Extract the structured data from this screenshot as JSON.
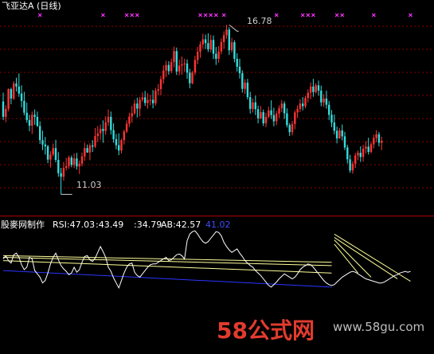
{
  "header": {
    "title": "飞亚达A (日线)"
  },
  "price_labels": {
    "high": "16.78",
    "low": "11.03"
  },
  "indicator": {
    "name": "股麥网制作",
    "rsi_label": "RSI:47.03",
    "val2": ":43.49",
    "val3": ":34.79",
    "ab_label": "AB:42.57",
    "ab2": "41.02"
  },
  "watermark": {
    "num": "58",
    "text": "公式网",
    "url": "www.58gu.com"
  },
  "colors": {
    "up_candle": "#ff3333",
    "down_candle": "#33dddd",
    "indicator_line": "#ffffff",
    "trend_line_yellow": "#ffff99",
    "trend_line_blue": "#2b35ff",
    "marker": "#ff33ff",
    "gridline": "#8b0000",
    "panel_divider": "#b30000"
  },
  "chart_data": [
    {
      "type": "candlestick",
      "title": "飞亚达A (日线)",
      "ylim": [
        10.5,
        17.3
      ],
      "grid": true,
      "annotations": [
        {
          "text": "16.78",
          "kind": "high",
          "at_index": 86,
          "value": 16.78
        },
        {
          "text": "11.03",
          "kind": "low",
          "at_index": 22,
          "value": 11.03
        }
      ],
      "signal_marker_indices": [
        14,
        38,
        47,
        49,
        51,
        75,
        77,
        79,
        81,
        84,
        104,
        114,
        116,
        118,
        127,
        129,
        141,
        155
      ],
      "ohlc": [
        [
          14.18,
          14.48,
          13.55,
          13.66
        ],
        [
          13.66,
          14.05,
          13.48,
          13.93
        ],
        [
          13.93,
          14.63,
          13.85,
          14.6
        ],
        [
          14.6,
          14.65,
          14.09,
          14.28
        ],
        [
          14.28,
          14.87,
          14.23,
          14.79
        ],
        [
          14.79,
          14.99,
          14.52,
          14.69
        ],
        [
          14.69,
          15.13,
          14.34,
          14.45
        ],
        [
          14.45,
          14.73,
          13.98,
          14.2
        ],
        [
          14.2,
          14.51,
          13.71,
          13.8
        ],
        [
          13.8,
          14.14,
          13.46,
          13.55
        ],
        [
          13.55,
          13.73,
          13.17,
          13.36
        ],
        [
          13.36,
          13.84,
          13.08,
          13.73
        ],
        [
          13.73,
          13.91,
          13.39,
          13.66
        ],
        [
          13.66,
          13.84,
          13.32,
          13.35
        ],
        [
          13.35,
          13.51,
          12.74,
          12.87
        ],
        [
          12.87,
          13.19,
          12.53,
          12.72
        ],
        [
          12.72,
          12.98,
          12.38,
          12.66
        ],
        [
          12.66,
          12.71,
          12.09,
          12.21
        ],
        [
          12.21,
          12.5,
          11.94,
          12.38
        ],
        [
          12.38,
          12.75,
          12.32,
          12.6
        ],
        [
          12.6,
          12.88,
          12.12,
          12.2
        ],
        [
          12.2,
          12.46,
          11.63,
          11.75
        ],
        [
          11.75,
          11.93,
          11.03,
          11.63
        ],
        [
          11.63,
          12.13,
          11.49,
          11.93
        ],
        [
          11.93,
          12.27,
          11.84,
          11.99
        ],
        [
          11.99,
          12.34,
          11.9,
          12.28
        ],
        [
          12.28,
          12.35,
          11.95,
          12.03
        ],
        [
          12.03,
          12.42,
          11.92,
          12.25
        ],
        [
          12.25,
          12.44,
          11.87,
          11.98
        ],
        [
          11.98,
          12.18,
          11.72,
          12.07
        ],
        [
          12.07,
          12.45,
          11.98,
          12.32
        ],
        [
          12.32,
          12.78,
          12.17,
          12.6
        ],
        [
          12.6,
          12.72,
          12.44,
          12.45
        ],
        [
          12.45,
          12.76,
          12.19,
          12.69
        ],
        [
          12.69,
          12.87,
          12.47,
          12.65
        ],
        [
          12.65,
          13.28,
          12.6,
          13.01
        ],
        [
          13.01,
          13.35,
          12.8,
          13.1
        ],
        [
          13.1,
          13.4,
          12.88,
          13.25
        ],
        [
          13.25,
          13.54,
          12.78,
          13.18
        ],
        [
          13.18,
          13.68,
          13.05,
          13.47
        ],
        [
          13.47,
          13.91,
          13.35,
          13.66
        ],
        [
          13.66,
          13.84,
          13.06,
          13.21
        ],
        [
          13.21,
          13.44,
          12.78,
          12.9
        ],
        [
          12.9,
          13.08,
          12.56,
          12.7
        ],
        [
          12.7,
          13.1,
          12.36,
          12.52
        ],
        [
          12.52,
          12.92,
          12.42,
          12.87
        ],
        [
          12.87,
          13.23,
          12.72,
          13.16
        ],
        [
          13.16,
          13.54,
          13.11,
          13.43
        ],
        [
          13.43,
          13.8,
          13.32,
          13.67
        ],
        [
          13.67,
          14.03,
          13.46,
          13.78
        ],
        [
          13.78,
          14.24,
          13.73,
          14.11
        ],
        [
          14.11,
          14.31,
          13.64,
          13.94
        ],
        [
          13.94,
          14.33,
          13.67,
          14.24
        ],
        [
          14.24,
          14.49,
          14.17,
          14.32
        ],
        [
          14.32,
          14.54,
          14.03,
          14.13
        ],
        [
          14.13,
          14.46,
          13.94,
          14.23
        ],
        [
          14.23,
          14.41,
          14.05,
          14.24
        ],
        [
          14.24,
          14.57,
          13.95,
          14.12
        ],
        [
          14.12,
          14.64,
          14.04,
          14.55
        ],
        [
          14.55,
          14.77,
          14.39,
          14.6
        ],
        [
          14.6,
          15.05,
          14.4,
          14.94
        ],
        [
          14.94,
          15.41,
          14.79,
          15.23
        ],
        [
          15.23,
          15.56,
          15.01,
          15.42
        ],
        [
          15.42,
          15.55,
          15.09,
          15.21
        ],
        [
          15.21,
          15.64,
          15.14,
          15.52
        ],
        [
          15.52,
          16.04,
          15.34,
          15.89
        ],
        [
          15.89,
          16.01,
          15.08,
          15.2
        ],
        [
          15.2,
          15.6,
          15.07,
          15.4
        ],
        [
          15.4,
          15.71,
          15.09,
          15.44
        ],
        [
          15.44,
          15.63,
          15.19,
          15.47
        ],
        [
          15.47,
          15.61,
          14.95,
          15.16
        ],
        [
          15.16,
          15.29,
          14.63,
          14.8
        ],
        [
          14.8,
          15.22,
          14.76,
          15.16
        ],
        [
          15.16,
          15.73,
          15.07,
          15.59
        ],
        [
          15.59,
          16.04,
          15.45,
          15.87
        ],
        [
          15.87,
          16.22,
          15.66,
          16.12
        ],
        [
          16.12,
          16.48,
          15.97,
          16.29
        ],
        [
          16.29,
          16.45,
          15.96,
          16.16
        ],
        [
          16.16,
          16.49,
          15.86,
          15.95
        ],
        [
          15.95,
          16.44,
          15.85,
          16.27
        ],
        [
          16.27,
          16.42,
          15.62,
          15.8
        ],
        [
          15.8,
          16.03,
          15.42,
          15.63
        ],
        [
          15.63,
          16.06,
          15.49,
          15.88
        ],
        [
          15.88,
          16.32,
          15.78,
          16.2
        ],
        [
          16.2,
          16.56,
          15.98,
          16.43
        ],
        [
          16.43,
          16.78,
          16.31,
          16.62
        ],
        [
          16.62,
          16.7,
          15.76,
          15.92
        ],
        [
          15.92,
          16.34,
          15.84,
          16.19
        ],
        [
          16.19,
          16.26,
          15.51,
          15.63
        ],
        [
          15.63,
          15.82,
          15.2,
          15.36
        ],
        [
          15.36,
          15.63,
          14.96,
          15.14
        ],
        [
          15.14,
          15.24,
          14.48,
          14.61
        ],
        [
          14.61,
          14.94,
          14.44,
          14.82
        ],
        [
          14.82,
          14.95,
          14.25,
          14.33
        ],
        [
          14.33,
          14.51,
          13.77,
          13.93
        ],
        [
          13.93,
          14.28,
          13.81,
          14.15
        ],
        [
          14.15,
          14.38,
          13.72,
          13.92
        ],
        [
          13.92,
          14.04,
          13.44,
          13.61
        ],
        [
          13.61,
          14.03,
          13.58,
          13.82
        ],
        [
          13.82,
          13.91,
          13.35,
          13.44
        ],
        [
          13.44,
          13.8,
          13.31,
          13.66
        ],
        [
          13.66,
          14.01,
          13.61,
          13.88
        ],
        [
          13.88,
          14.22,
          13.59,
          13.72
        ],
        [
          13.72,
          13.97,
          13.34,
          13.51
        ],
        [
          13.51,
          13.86,
          13.38,
          13.77
        ],
        [
          13.77,
          14.05,
          13.63,
          13.95
        ],
        [
          13.95,
          14.23,
          13.82,
          14.11
        ],
        [
          14.11,
          14.19,
          13.59,
          13.78
        ],
        [
          13.78,
          13.95,
          13.3,
          13.38
        ],
        [
          13.38,
          13.45,
          13.01,
          13.14
        ],
        [
          13.14,
          13.52,
          13.03,
          13.42
        ],
        [
          13.42,
          13.88,
          13.24,
          13.81
        ],
        [
          13.81,
          14.05,
          13.62,
          13.93
        ],
        [
          13.93,
          14.26,
          13.82,
          14.11
        ],
        [
          14.11,
          14.33,
          13.88,
          14.02
        ],
        [
          14.02,
          14.38,
          13.95,
          14.3
        ],
        [
          14.3,
          14.59,
          14.15,
          14.48
        ],
        [
          14.48,
          14.83,
          14.26,
          14.69
        ],
        [
          14.69,
          14.95,
          14.34,
          14.5
        ],
        [
          14.5,
          14.8,
          14.45,
          14.73
        ],
        [
          14.73,
          14.89,
          14.38,
          14.55
        ],
        [
          14.55,
          14.72,
          14.02,
          14.15
        ],
        [
          14.15,
          14.43,
          14.0,
          14.28
        ],
        [
          14.28,
          14.55,
          13.94,
          14.07
        ],
        [
          14.07,
          14.2,
          13.55,
          13.73
        ],
        [
          13.73,
          13.89,
          13.31,
          13.47
        ],
        [
          13.47,
          13.74,
          13.07,
          13.19
        ],
        [
          13.19,
          13.33,
          12.76,
          12.93
        ],
        [
          12.93,
          13.28,
          12.91,
          13.2
        ],
        [
          13.2,
          13.4,
          12.86,
          13.0
        ],
        [
          13.0,
          13.15,
          12.53,
          12.62
        ],
        [
          12.62,
          12.71,
          12.08,
          12.22
        ],
        [
          12.22,
          12.37,
          11.76,
          11.84
        ],
        [
          11.84,
          12.16,
          11.73,
          12.07
        ],
        [
          12.07,
          12.44,
          11.93,
          12.35
        ],
        [
          12.35,
          12.52,
          12.19,
          12.44
        ],
        [
          12.44,
          12.66,
          12.13,
          12.3
        ],
        [
          12.3,
          12.71,
          12.14,
          12.58
        ],
        [
          12.58,
          12.83,
          12.42,
          12.65
        ],
        [
          12.65,
          12.95,
          12.38,
          12.47
        ],
        [
          12.47,
          12.8,
          12.42,
          12.73
        ],
        [
          12.73,
          13.05,
          12.59,
          12.94
        ],
        [
          12.94,
          13.21,
          12.8,
          13.07
        ],
        [
          13.07,
          13.15,
          12.66,
          12.78
        ],
        [
          12.78,
          12.99,
          12.53,
          12.85
        ]
      ]
    },
    {
      "type": "line",
      "title": "股麥网制作",
      "ylim": [
        0,
        100
      ],
      "series": [
        {
          "name": "RSI",
          "values": [
            62,
            66,
            60,
            57,
            67,
            69,
            64,
            55,
            49,
            52,
            64,
            62,
            48,
            44,
            40,
            33,
            36,
            45,
            56,
            64,
            69,
            61,
            54,
            50,
            47,
            43,
            45,
            52,
            46,
            49,
            58,
            65,
            66,
            61,
            59,
            63,
            70,
            77,
            71,
            64,
            52,
            47,
            39,
            33,
            27,
            36,
            45,
            52,
            56,
            57,
            46,
            42,
            40,
            44,
            48,
            52,
            55,
            56,
            56,
            58,
            60,
            62,
            64,
            60,
            61,
            64,
            67,
            68,
            66,
            62,
            84,
            92,
            95,
            96,
            92,
            87,
            83,
            81,
            83,
            87,
            91,
            95,
            94,
            90,
            82,
            77,
            73,
            70,
            72,
            74,
            69,
            65,
            60,
            57,
            54,
            52,
            48,
            45,
            42,
            38,
            34,
            30,
            28,
            31,
            34,
            38,
            41,
            44,
            42,
            40,
            38,
            40,
            44,
            49,
            52,
            54,
            56,
            55,
            52,
            48,
            44,
            40,
            36,
            33,
            31,
            30,
            31,
            34,
            37,
            40,
            42,
            44,
            46,
            47,
            46,
            44,
            42,
            40,
            38,
            37,
            36,
            35,
            34,
            33,
            33,
            34,
            36,
            38,
            40,
            42,
            43,
            45,
            46,
            47,
            46,
            47
          ]
        },
        {
          "name": "trend lines",
          "lines": [
            [
              [
                0,
                66
              ],
              [
                125,
                58
              ]
            ],
            [
              [
                0,
                64
              ],
              [
                125,
                54
              ]
            ],
            [
              [
                0,
                60
              ],
              [
                125,
                45
              ]
            ],
            [
              [
                0,
                48
              ],
              [
                125,
                28
              ]
            ],
            [
              [
                126,
                92
              ],
              [
                155,
                35
              ]
            ],
            [
              [
                126,
                88
              ],
              [
                150,
                38
              ]
            ],
            [
              [
                126,
                85
              ],
              [
                140,
                40
              ]
            ],
            [
              [
                126,
                80
              ],
              [
                135,
                45
              ]
            ]
          ]
        }
      ],
      "labels": [
        "RSI:47.03",
        ":43.49",
        ":34.79",
        "AB:42.57",
        "41.02"
      ]
    }
  ]
}
